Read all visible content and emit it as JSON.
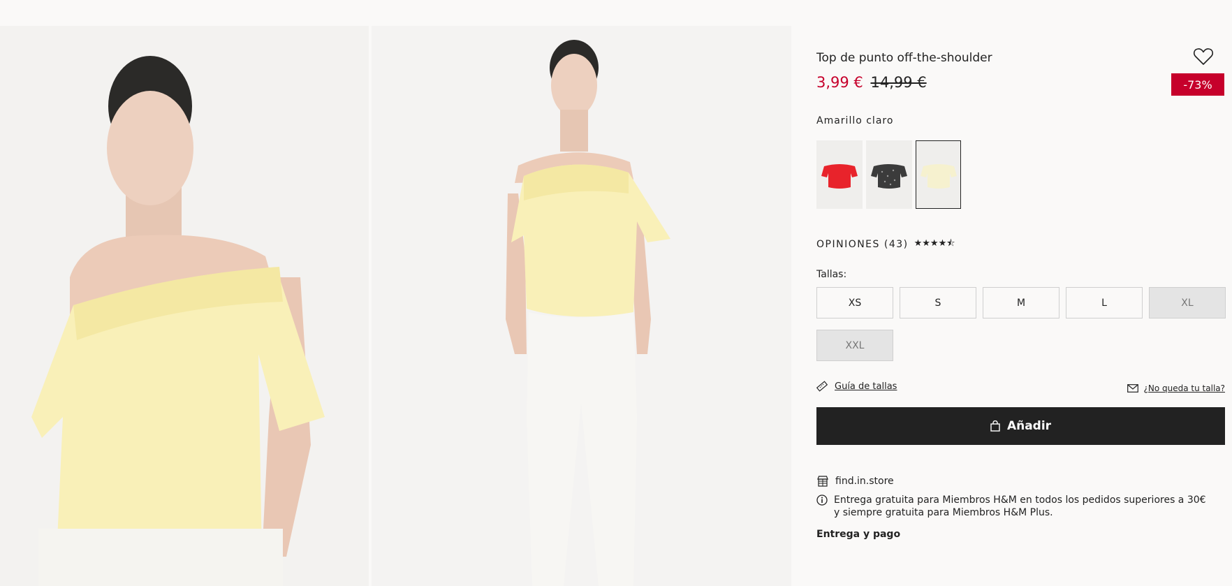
{
  "product": {
    "title": "Top de punto off-the-shoulder",
    "price_now": "3,99 €",
    "price_old": "14,99 €",
    "discount": "-73%",
    "color_name": "Amarillo claro"
  },
  "swatches": [
    {
      "color": "#e8232b",
      "name": "Rojo"
    },
    {
      "color": "#3b3b3b",
      "name": "Estampado negro"
    },
    {
      "color": "#f6f1cf",
      "name": "Amarillo claro",
      "selected": true
    }
  ],
  "reviews": {
    "label": "OPINIONES (43)",
    "stars": "★★★★⯪",
    "rating": 4.5
  },
  "sizes": {
    "label": "Tallas:",
    "options": [
      {
        "label": "XS",
        "available": true
      },
      {
        "label": "S",
        "available": true
      },
      {
        "label": "M",
        "available": true
      },
      {
        "label": "L",
        "available": true
      },
      {
        "label": "XL",
        "available": false
      },
      {
        "label": "XXL",
        "available": false
      }
    ]
  },
  "links": {
    "size_guide": "Guía de tallas",
    "not_your_size": "¿No queda tu talla?"
  },
  "add_button": "Añadir",
  "store": "find.in.store",
  "delivery_info": "Entrega gratuita para Miembros H&M en todos los pedidos superiores a 30€ y siempre gratuita para Miembros H&M Plus.",
  "delivery_link": "Entrega y pago",
  "colors": {
    "sale_red": "#c6002b",
    "button_dark": "#222222",
    "page_bg": "#faf9f8"
  }
}
